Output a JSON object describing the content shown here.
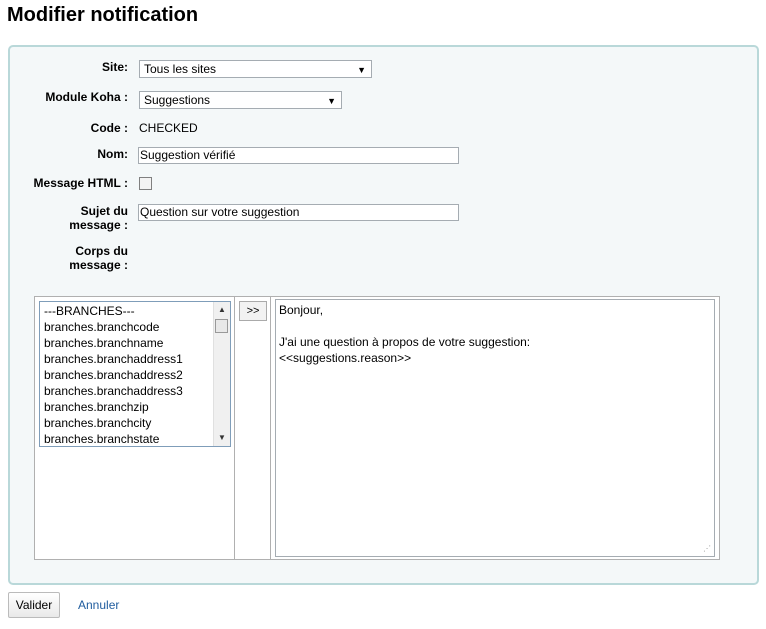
{
  "page": {
    "title": "Modifier notification"
  },
  "form": {
    "site": {
      "label": "Site:",
      "value": "Tous les sites"
    },
    "module": {
      "label": "Module Koha :",
      "value": "Suggestions"
    },
    "code": {
      "label": "Code :",
      "value": "CHECKED"
    },
    "name": {
      "label": "Nom:",
      "value": "Suggestion vérifié"
    },
    "html_message": {
      "label": "Message HTML :",
      "checked": false
    },
    "subject": {
      "label_line1": "Sujet du",
      "label_line2": "message :",
      "value": "Question sur votre suggestion"
    },
    "body": {
      "label_line1": "Corps du",
      "label_line2": "message :"
    }
  },
  "editor": {
    "fields": [
      "---BRANCHES---",
      "branches.branchcode",
      "branches.branchname",
      "branches.branchaddress1",
      "branches.branchaddress2",
      "branches.branchaddress3",
      "branches.branchzip",
      "branches.branchcity",
      "branches.branchstate"
    ],
    "insert_label": ">>",
    "body_lines": [
      "Bonjour,",
      "",
      "J'ai une question à propos de votre suggestion:",
      "<<suggestions.reason>>"
    ]
  },
  "actions": {
    "submit_label": "Valider",
    "cancel_label": "Annuler"
  }
}
